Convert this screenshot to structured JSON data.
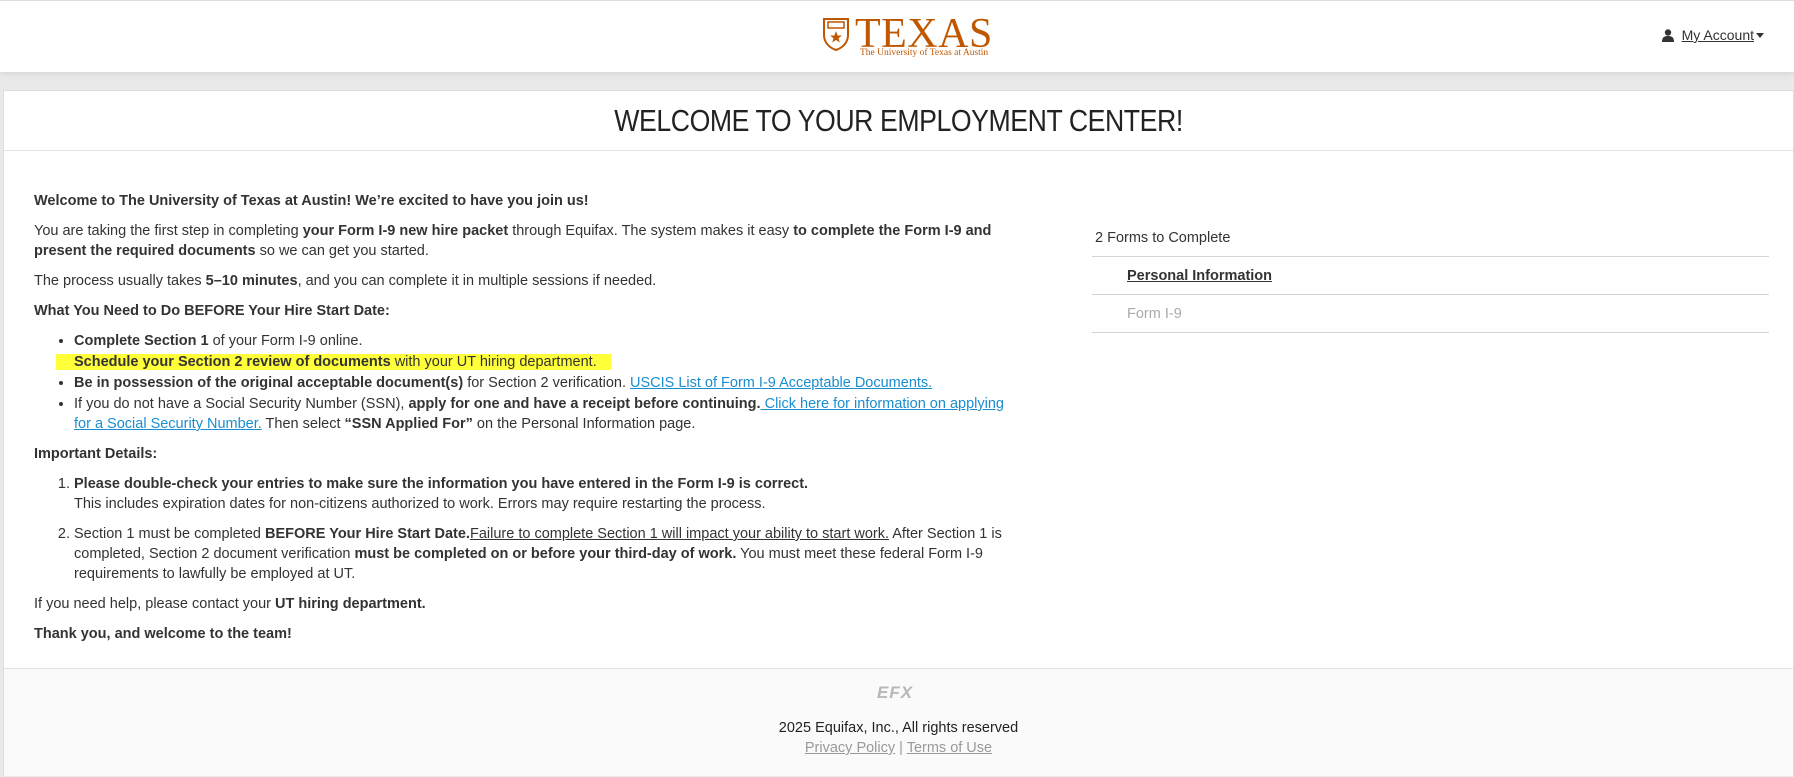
{
  "header": {
    "logo_word": "TEXAS",
    "logo_sub": "The University of Texas at Austin",
    "account_label": "My Account"
  },
  "page": {
    "title": "WELCOME TO YOUR EMPLOYMENT CENTER!"
  },
  "content": {
    "welcome": "Welcome to The University of Texas at Austin! We’re excited to have you join us!",
    "intro": {
      "t1": "You are taking the first step in completing ",
      "b1": "your Form I-9 new hire packet",
      "t2": " through Equifax. The system makes it easy ",
      "b2": "to complete the Form I-9 and present the required documents",
      "t3": " so we can get you started."
    },
    "process": {
      "t1": "The process usually takes ",
      "b1": "5–10 minutes",
      "t2": ", and you can complete it in multiple sessions if needed."
    },
    "before_heading": "What You Need to Do BEFORE Your Hire Start Date:",
    "bullets": {
      "b1_bold": "Complete Section 1",
      "b1_text": " of your Form I-9 online.",
      "b2_bold": "Schedule your Section 2 review of documents",
      "b2_text": " with your UT hiring department.",
      "b3_bold": "Be in possession of the original acceptable document(s)",
      "b3_text": " for Section 2 verification. ",
      "b3_link": "USCIS List of Form I-9 Acceptable Documents.",
      "b4_t1": "If you do not have a Social Security Number (SSN), ",
      "b4_bold": "apply for one and have a receipt before continuing.",
      "b4_link": " Click here for information on applying for a Social Security Number.",
      "b4_t2": " Then select ",
      "b4_bold2": "“SSN Applied For”",
      "b4_t3": " on the Personal Information page."
    },
    "important_heading": "Important Details:",
    "details": {
      "d1_bold": "Please double-check your entries to make sure the information you have entered in the Form I-9 is correct.",
      "d1_text": "This includes expiration dates for non-citizens authorized to work. Errors may require restarting the process.",
      "d2_t1": "Section 1 must be completed ",
      "d2_bold1": "BEFORE Your Hire Start Date.",
      "d2_ul": "Failure to complete Section 1 will impact your ability to start work.",
      "d2_t2": " After Section 1 is completed, Section 2 document verification ",
      "d2_bold2": "must be completed on or before your third-day of work.",
      "d2_t3": " You must meet these federal Form I-9 requirements to lawfully be employed at UT."
    },
    "help": {
      "t1": "If you need help, please contact your ",
      "b1": "UT hiring department."
    },
    "thanks": "Thank you, and welcome to the team!"
  },
  "forms_panel": {
    "count_label": "2 Forms to Complete",
    "items": [
      {
        "label": "Personal Information",
        "state": "active"
      },
      {
        "label": "Form I-9",
        "state": "disabled"
      }
    ]
  },
  "footer": {
    "logo_text": "EFX",
    "copyright": "2025 Equifax, Inc., All rights reserved",
    "privacy": "Privacy Policy",
    "separator": " | ",
    "terms": "Terms of Use"
  },
  "colors": {
    "brand_orange": "#bf5700",
    "link_blue": "#1a8ecf",
    "highlight_yellow": "#ffff3a"
  }
}
